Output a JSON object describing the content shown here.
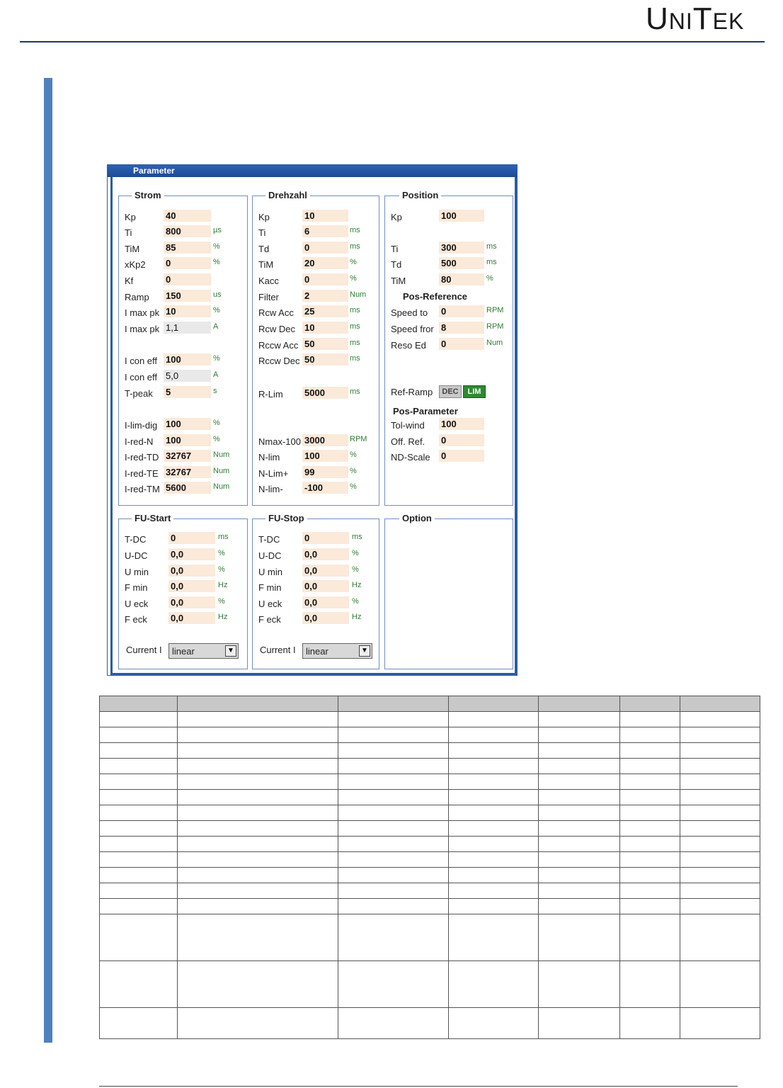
{
  "logo": {
    "u": "U",
    "ni": "NI",
    "t": "T",
    "ek": "EK"
  },
  "window": {
    "title": "Parameter"
  },
  "strom": {
    "title": "Strom",
    "rows": [
      {
        "label": "Kp",
        "value": "40",
        "unit": ""
      },
      {
        "label": "Ti",
        "value": "800",
        "unit": "µs"
      },
      {
        "label": "TiM",
        "value": "85",
        "unit": "%"
      },
      {
        "label": "xKp2",
        "value": "0",
        "unit": "%"
      },
      {
        "label": "Kf",
        "value": "0",
        "unit": ""
      },
      {
        "label": "Ramp",
        "value": "150",
        "unit": "us"
      },
      {
        "label": "I max pk",
        "value": "10",
        "unit": "%"
      },
      {
        "label": "I max pk",
        "value": "1,1",
        "unit": "A"
      },
      {
        "label": "I con eff",
        "value": "100",
        "unit": "%"
      },
      {
        "label": "I con eff",
        "value": "5,0",
        "unit": "A"
      },
      {
        "label": "T-peak",
        "value": "5",
        "unit": "s"
      },
      {
        "label": "I-lim-dig",
        "value": "100",
        "unit": "%"
      },
      {
        "label": "I-red-N",
        "value": "100",
        "unit": "%"
      },
      {
        "label": "I-red-TD",
        "value": "32767",
        "unit": "Num"
      },
      {
        "label": "I-red-TE",
        "value": "32767",
        "unit": "Num"
      },
      {
        "label": "I-red-TM",
        "value": "5600",
        "unit": "Num"
      }
    ]
  },
  "drehzahl": {
    "title": "Drehzahl",
    "rows": [
      {
        "label": "Kp",
        "value": "10",
        "unit": ""
      },
      {
        "label": "Ti",
        "value": "6",
        "unit": "ms"
      },
      {
        "label": "Td",
        "value": "0",
        "unit": "ms"
      },
      {
        "label": "TiM",
        "value": "20",
        "unit": "%"
      },
      {
        "label": "Kacc",
        "value": "0",
        "unit": "%"
      },
      {
        "label": "Filter",
        "value": "2",
        "unit": "Num"
      },
      {
        "label": "Rcw Acc",
        "value": "25",
        "unit": "ms"
      },
      {
        "label": "Rcw Dec",
        "value": "10",
        "unit": "ms"
      },
      {
        "label": "Rccw Acc",
        "value": "50",
        "unit": "ms"
      },
      {
        "label": "Rccw Dec",
        "value": "50",
        "unit": "ms"
      },
      {
        "label": "R-Lim",
        "value": "5000",
        "unit": "ms"
      },
      {
        "label": "Nmax-100",
        "value": "3000",
        "unit": "RPM"
      },
      {
        "label": "N-lim",
        "value": "100",
        "unit": "%"
      },
      {
        "label": "N-Lim+",
        "value": "99",
        "unit": "%"
      },
      {
        "label": "N-lim-",
        "value": "-100",
        "unit": "%"
      }
    ]
  },
  "position": {
    "title": "Position",
    "rows": [
      {
        "label": "Kp",
        "value": "100",
        "unit": ""
      },
      {
        "label": "Ti",
        "value": "300",
        "unit": "ms"
      },
      {
        "label": "Td",
        "value": "500",
        "unit": "ms"
      },
      {
        "label": "TiM",
        "value": "80",
        "unit": "%"
      }
    ],
    "pos_reference_title": "Pos-Reference",
    "ref_rows": [
      {
        "label": "Speed to",
        "value": "0",
        "unit": "RPM"
      },
      {
        "label": "Speed fror",
        "value": "8",
        "unit": "RPM"
      },
      {
        "label": "Reso Ed",
        "value": "0",
        "unit": "Num"
      }
    ],
    "ref_ramp_label": "Ref-Ramp",
    "dec_label": "DEC",
    "lim_label": "LIM",
    "pos_parameter_title": "Pos-Parameter",
    "par_rows": [
      {
        "label": "Tol-wind",
        "value": "100",
        "unit": ""
      },
      {
        "label": "Off. Ref.",
        "value": "0",
        "unit": ""
      },
      {
        "label": "ND-Scale",
        "value": "0",
        "unit": ""
      }
    ]
  },
  "fu_start": {
    "title": "FU-Start",
    "rows": [
      {
        "label": "T-DC",
        "value": "0",
        "unit": "ms"
      },
      {
        "label": "U-DC",
        "value": "0,0",
        "unit": "%"
      },
      {
        "label": "U min",
        "value": "0,0",
        "unit": "%"
      },
      {
        "label": "F min",
        "value": "0,0",
        "unit": "Hz"
      },
      {
        "label": "U eck",
        "value": "0,0",
        "unit": "%"
      },
      {
        "label": "F eck",
        "value": "0,0",
        "unit": "Hz"
      }
    ],
    "current_label": "Current I",
    "current_value": "linear"
  },
  "fu_stop": {
    "title": "FU-Stop",
    "rows": [
      {
        "label": "T-DC",
        "value": "0",
        "unit": "ms"
      },
      {
        "label": "U-DC",
        "value": "0,0",
        "unit": "%"
      },
      {
        "label": "U min",
        "value": "0,0",
        "unit": "%"
      },
      {
        "label": "F min",
        "value": "0,0",
        "unit": "Hz"
      },
      {
        "label": "U eck",
        "value": "0,0",
        "unit": "%"
      },
      {
        "label": "F eck",
        "value": "0,0",
        "unit": "Hz"
      }
    ],
    "current_label": "Current I",
    "current_value": "linear"
  },
  "option": {
    "title": "Option"
  }
}
